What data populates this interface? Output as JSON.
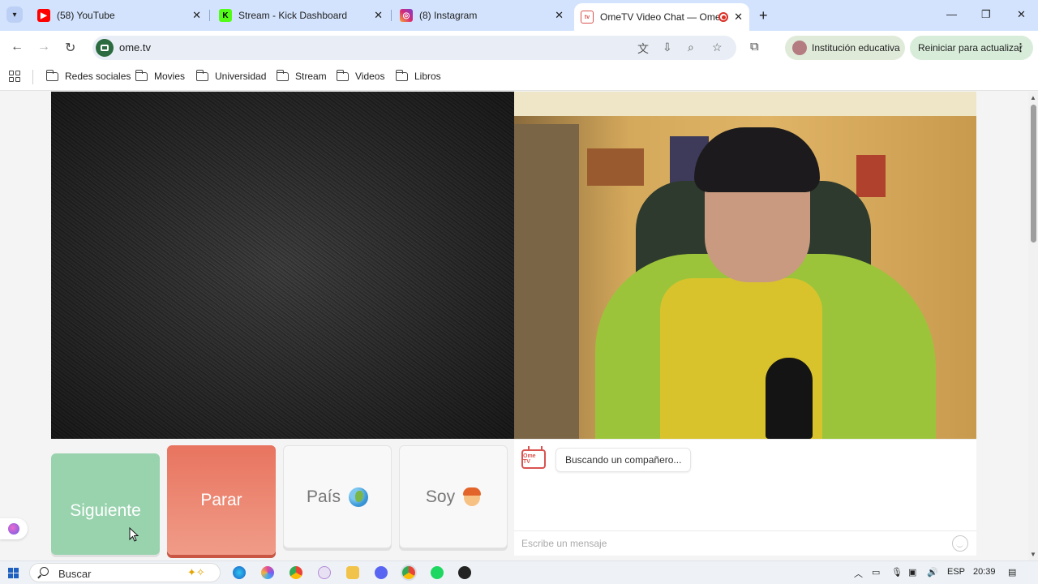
{
  "browser": {
    "tabs": [
      {
        "title": "(58) YouTube",
        "icon": "youtube-icon",
        "color": "#ff0000"
      },
      {
        "title": "Stream - Kick Dashboard",
        "icon": "kick-icon",
        "color": "#53fc18"
      },
      {
        "title": "(8) Instagram",
        "icon": "instagram-icon",
        "color": "#d62976"
      },
      {
        "title": "OmeTV Video Chat — Ome",
        "icon": "ometv-icon",
        "color": "#d9534f",
        "active": true
      }
    ],
    "url": "ome.tv",
    "profile_label": "Institución educativa",
    "update_label": "Reiniciar para actualizar",
    "bookmarks": [
      "Redes sociales",
      "Movies",
      "Universidad",
      "Stream",
      "Videos",
      "Libros"
    ]
  },
  "page": {
    "buttons": {
      "next": "Siguiente",
      "stop": "Parar",
      "country": "País",
      "gender": "Soy"
    },
    "chat": {
      "logo_text": "Ome TV",
      "status_message": "Buscando un compañero...",
      "input_placeholder": "Escribe un mensaje"
    }
  },
  "taskbar": {
    "search_label": "Buscar",
    "language": "ESP",
    "time": "20:39"
  }
}
